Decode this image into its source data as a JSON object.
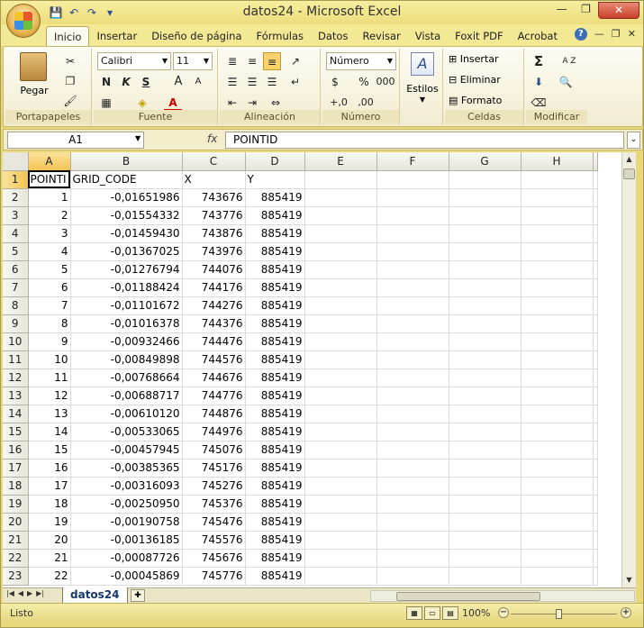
{
  "window": {
    "title": "datos24 - Microsoft Excel",
    "controls": {
      "minimize": "—",
      "maximize": "❐",
      "close": "✕"
    }
  },
  "quick_access": {
    "save": "💾",
    "undo": "↶",
    "redo": "↷",
    "more": "▾"
  },
  "ribbon_tabs": [
    "Inicio",
    "Insertar",
    "Diseño de página",
    "Fórmulas",
    "Datos",
    "Revisar",
    "Vista",
    "Foxit PDF",
    "Acrobat"
  ],
  "active_tab": "Inicio",
  "ribbon": {
    "clipboard": {
      "paste_label": "Pegar",
      "group_label": "Portapapeles"
    },
    "font": {
      "font_name": "Calibri",
      "font_size": "11",
      "bold": "N",
      "italic": "K",
      "underline": "S",
      "grow": "A",
      "shrink": "A",
      "font_color": "A",
      "group_label": "Fuente"
    },
    "alignment": {
      "group_label": "Alineación"
    },
    "number": {
      "format": "Número",
      "currency": "$",
      "percent": "%",
      "thousands": "000",
      "inc_dec": "+,0",
      "dec_dec": ",00",
      "group_label": "Número"
    },
    "styles": {
      "label": "Estilos"
    },
    "cells": {
      "insert": "Insertar",
      "delete": "Eliminar",
      "format": "Formato",
      "group_label": "Celdas"
    },
    "editing": {
      "sum": "Σ",
      "sort": "A Z",
      "group_label": "Modificar"
    }
  },
  "formula_bar": {
    "name_box": "A1",
    "fx": "fx",
    "value": "POINTID"
  },
  "columns": [
    "A",
    "B",
    "C",
    "D",
    "E",
    "F",
    "G",
    "H"
  ],
  "header_row": [
    "POINTI",
    "GRID_CODE",
    "X",
    "Y",
    "",
    "",
    "",
    ""
  ],
  "rows": [
    [
      "1",
      "-0,01651986",
      "743676",
      "885419"
    ],
    [
      "2",
      "-0,01554332",
      "743776",
      "885419"
    ],
    [
      "3",
      "-0,01459430",
      "743876",
      "885419"
    ],
    [
      "4",
      "-0,01367025",
      "743976",
      "885419"
    ],
    [
      "5",
      "-0,01276794",
      "744076",
      "885419"
    ],
    [
      "6",
      "-0,01188424",
      "744176",
      "885419"
    ],
    [
      "7",
      "-0,01101672",
      "744276",
      "885419"
    ],
    [
      "8",
      "-0,01016378",
      "744376",
      "885419"
    ],
    [
      "9",
      "-0,00932466",
      "744476",
      "885419"
    ],
    [
      "10",
      "-0,00849898",
      "744576",
      "885419"
    ],
    [
      "11",
      "-0,00768664",
      "744676",
      "885419"
    ],
    [
      "12",
      "-0,00688717",
      "744776",
      "885419"
    ],
    [
      "13",
      "-0,00610120",
      "744876",
      "885419"
    ],
    [
      "14",
      "-0,00533065",
      "744976",
      "885419"
    ],
    [
      "15",
      "-0,00457945",
      "745076",
      "885419"
    ],
    [
      "16",
      "-0,00385365",
      "745176",
      "885419"
    ],
    [
      "17",
      "-0,00316093",
      "745276",
      "885419"
    ],
    [
      "18",
      "-0,00250950",
      "745376",
      "885419"
    ],
    [
      "19",
      "-0,00190758",
      "745476",
      "885419"
    ],
    [
      "20",
      "-0,00136185",
      "745576",
      "885419"
    ],
    [
      "21",
      "-0,00087726",
      "745676",
      "885419"
    ],
    [
      "22",
      "-0,00045869",
      "745776",
      "885419"
    ]
  ],
  "sheet_tab": "datos24",
  "status": {
    "mode": "Listo",
    "zoom": "100%"
  },
  "colors": {
    "frame": "#e8d87a",
    "selected_header": "#f3c352",
    "tab_text": "#16386e"
  }
}
